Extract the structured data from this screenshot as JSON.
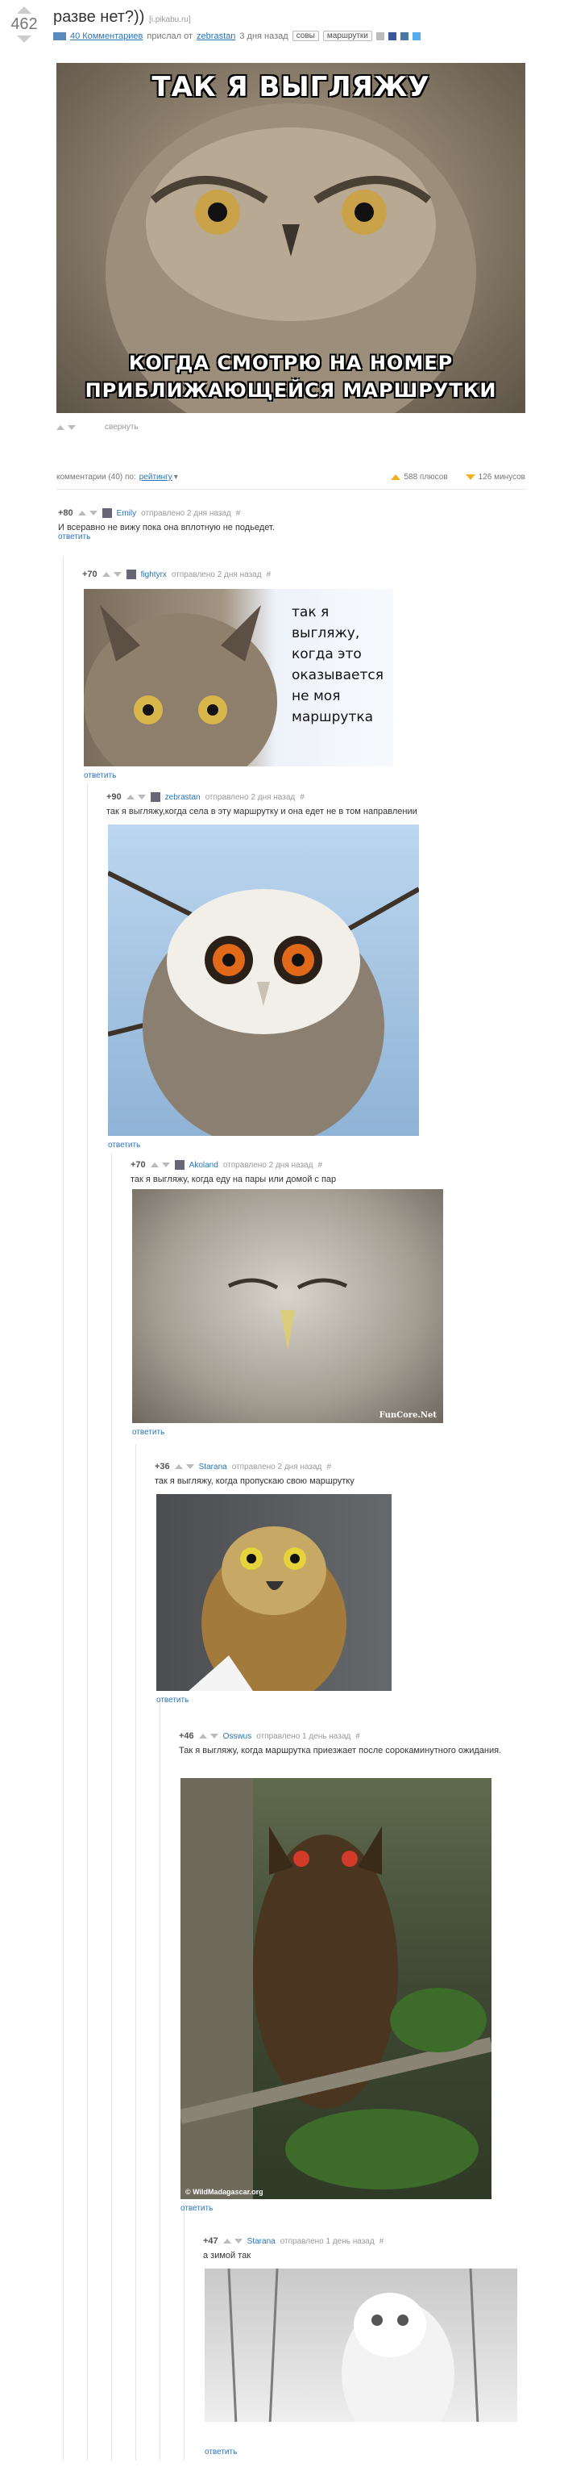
{
  "post": {
    "rating": "462",
    "title": "разве нет?))",
    "source": "[i.pikabu.ru]",
    "comments_link": "40 Комментариев",
    "posted_text": "прислал от",
    "author": "zebrastan",
    "time": "3 дня назад",
    "tags": [
      "совы",
      "маршрутки"
    ],
    "image_top_text": "ТАК Я ВЫГЛЯЖУ",
    "image_bottom_text_1": "КОГДА СМОТРЮ НА НОМЕР",
    "image_bottom_text_2": "ПРИБЛИЖАЮЩЕЙСЯ МАРШРУТКИ",
    "share_label": "свернуть"
  },
  "comments_bar": {
    "label": "комментарии (40) по:",
    "sort": "рейтингу",
    "pluses": "588 плюсов",
    "minuses": "126 минусов"
  },
  "comments": [
    {
      "score": "+80",
      "user": "Emily",
      "meta": "отправлено 2 дня назад",
      "hash": "#",
      "text": "И всеравно не вижу пока она вплотную не подьедет.",
      "reply": "ответить"
    },
    {
      "score": "+70",
      "user": "fightyrx",
      "meta": "отправлено 2 дня назад",
      "hash": "#",
      "text": "",
      "image_text": "так я выгляжу, когда это оказывается не моя маршрутка",
      "reply": "ответить"
    },
    {
      "score": "+90",
      "user": "zebrastan",
      "meta": "отправлено 2 дня назад",
      "hash": "#",
      "text": "так я выгляжу,когда села в эту маршрутку и она едет не в том направлении",
      "reply": "ответить"
    },
    {
      "score": "+70",
      "user": "Akoland",
      "meta": "отправлено 2 дня назад",
      "hash": "#",
      "text": "так я выгляжу, когда еду на пары или домой с пар",
      "watermark": "FunCore.Net",
      "reply": "ответить"
    },
    {
      "score": "+36",
      "user": "Starana",
      "meta": "отправлено 2 дня назад",
      "hash": "#",
      "text": "так я выгляжу, когда пропускаю свою маршрутку",
      "reply": "ответить"
    },
    {
      "score": "+46",
      "user": "Osswus",
      "meta": "отправлено 1 день назад",
      "hash": "#",
      "text": "Так я выгляжу, когда маршрутка приезжает после сорокаминутного ожидания.",
      "watermark": "© WildMadagascar.org",
      "reply": "ответить"
    },
    {
      "score": "+47",
      "user": "Starana",
      "meta": "отправлено 1 день назад",
      "hash": "#",
      "text": "а зимой так",
      "reply": "ответить"
    }
  ]
}
